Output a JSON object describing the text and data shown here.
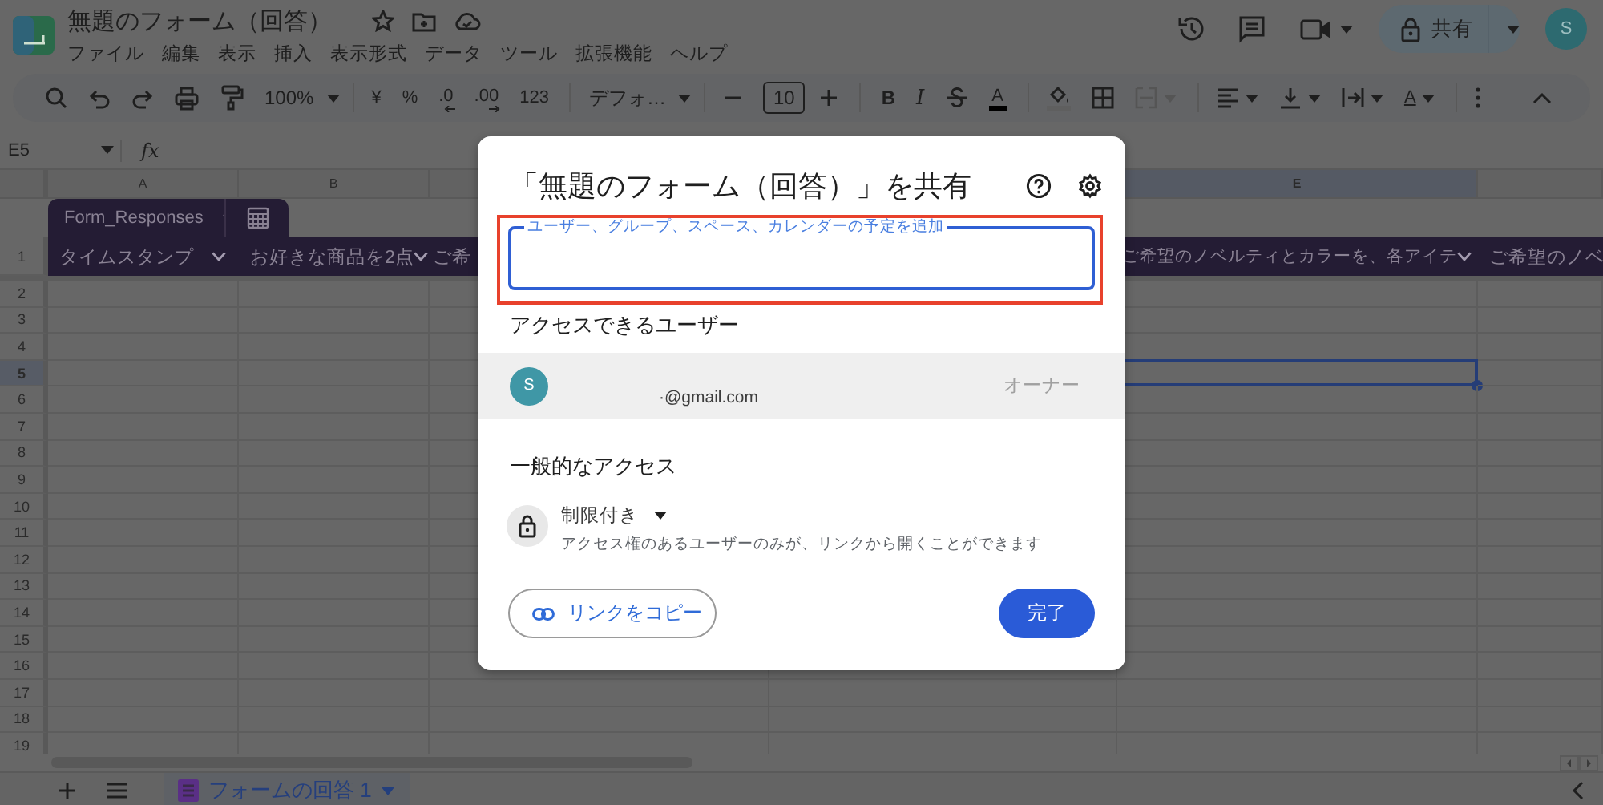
{
  "app": {
    "title": "無題のフォーム（回答）",
    "menu": [
      "ファイル",
      "編集",
      "表示",
      "挿入",
      "表示形式",
      "データ",
      "ツール",
      "拡張機能",
      "ヘルプ"
    ],
    "share_button": {
      "label": "共有"
    },
    "account_initial": "S"
  },
  "toolbar": [
    {
      "kind": "search"
    },
    {
      "kind": "undo"
    },
    {
      "kind": "redo"
    },
    {
      "kind": "print"
    },
    {
      "kind": "paint"
    },
    {
      "kind": "menu",
      "label": "100%"
    },
    {
      "kind": "divider"
    },
    {
      "kind": "text",
      "label": "¥"
    },
    {
      "kind": "text",
      "label": "%"
    },
    {
      "kind": "dec-less",
      "label": ".0"
    },
    {
      "kind": "dec-more",
      "label": ".00"
    },
    {
      "kind": "text",
      "label": "123"
    },
    {
      "kind": "divider"
    },
    {
      "kind": "menu",
      "label": "デフォ…"
    },
    {
      "kind": "divider"
    },
    {
      "kind": "minus"
    },
    {
      "kind": "field",
      "label": "10"
    },
    {
      "kind": "plus"
    },
    {
      "kind": "divider"
    },
    {
      "kind": "bold",
      "label": "B"
    },
    {
      "kind": "italic",
      "label": "I"
    },
    {
      "kind": "strike"
    },
    {
      "kind": "textcolor",
      "label": "A"
    },
    {
      "kind": "divider"
    },
    {
      "kind": "fill"
    },
    {
      "kind": "borders"
    },
    {
      "kind": "merge"
    },
    {
      "kind": "divider"
    },
    {
      "kind": "align"
    },
    {
      "kind": "valign"
    },
    {
      "kind": "wrap"
    },
    {
      "kind": "rotate",
      "label": "A"
    },
    {
      "kind": "divider"
    },
    {
      "kind": "more"
    },
    {
      "kind": "collapse"
    }
  ],
  "formula_bar": {
    "cell_ref": "E5",
    "fx": "fx"
  },
  "sheet": {
    "columns": [
      {
        "label": "A",
        "selected": false
      },
      {
        "label": "B",
        "selected": false
      },
      {
        "selected": false
      },
      {
        "label": "E",
        "selected": true
      },
      {
        "selected": false
      }
    ],
    "header_row_label": "1",
    "table_name": "Form_Responses",
    "header_cells": [
      {
        "text": "タイムスタンプ",
        "dropdown": true
      },
      {
        "text": "お好きな商品を2点",
        "dropdown": true
      },
      {
        "text": "ご希",
        "dropdown": false
      },
      {
        "text": "ご希望のノベルティとカラーを、各アイテ",
        "dropdown": true
      },
      {
        "text": "ご希望のノベ",
        "dropdown": false
      }
    ],
    "rows": [
      {
        "label": "2",
        "selected": false
      },
      {
        "label": "3",
        "selected": false
      },
      {
        "label": "4",
        "selected": false
      },
      {
        "label": "5",
        "selected": true
      },
      {
        "label": "6",
        "selected": false
      },
      {
        "label": "7",
        "selected": false
      },
      {
        "label": "8",
        "selected": false
      },
      {
        "label": "9",
        "selected": false
      },
      {
        "label": "10",
        "selected": false
      },
      {
        "label": "11",
        "selected": false
      },
      {
        "label": "12",
        "selected": false
      },
      {
        "label": "13",
        "selected": false
      },
      {
        "label": "14",
        "selected": false
      },
      {
        "label": "15",
        "selected": false
      },
      {
        "label": "16",
        "selected": false
      },
      {
        "label": "17",
        "selected": false
      },
      {
        "label": "18",
        "selected": false
      },
      {
        "label": "19",
        "selected": false
      }
    ]
  },
  "sheet_tabs": [
    {
      "label": "フォームの回答 1",
      "selected": true
    }
  ],
  "dialog": {
    "title": "「無題のフォーム（回答）」を共有",
    "input": {
      "label": "ユーザー、グループ、スペース、カレンダーの予定を追加",
      "highlighted": true
    },
    "people_heading": "アクセスできるユーザー",
    "people": [
      {
        "initial": "S",
        "email": "·@gmail.com",
        "role": "オーナー"
      }
    ],
    "general_heading": "一般的なアクセス",
    "access": {
      "level": "制限付き",
      "description": "アクセス権のあるユーザーのみが、リンクから開くことができます"
    },
    "copy_link": "リンクをコピー",
    "done": "完了"
  }
}
